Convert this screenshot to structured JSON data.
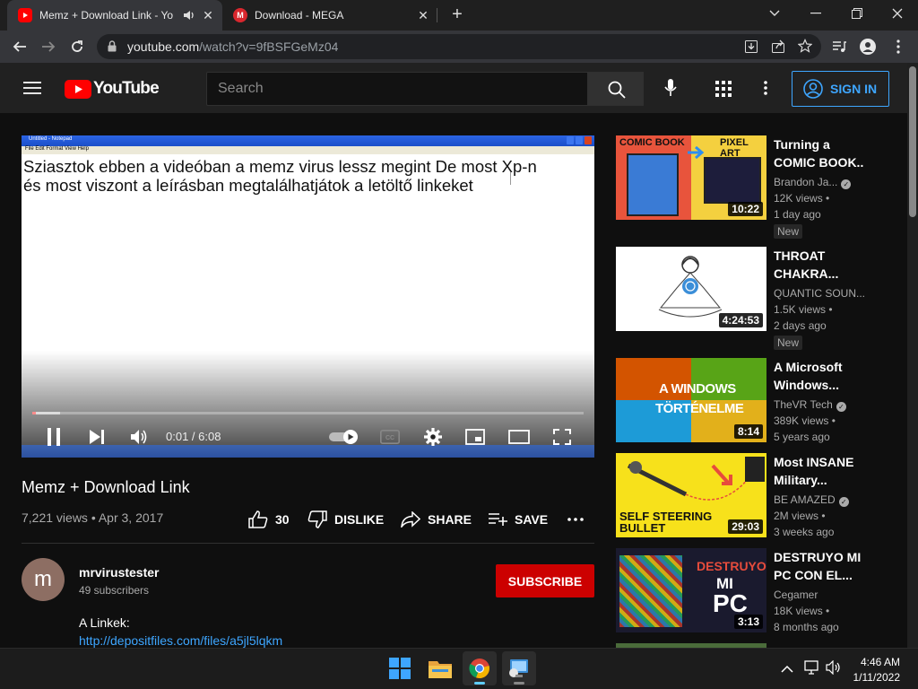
{
  "browser": {
    "tabs": [
      {
        "title": "Memz + Download Link - Yo",
        "favicon": "youtube-favicon",
        "active": true
      },
      {
        "title": "Download - MEGA",
        "favicon": "mega-favicon",
        "active": false
      }
    ],
    "url": {
      "host": "youtube.com",
      "path": "/watch?v=9fBSFGeMz04"
    },
    "new_tab_label": "+"
  },
  "youtube": {
    "logo_text": "YouTube",
    "search_placeholder": "Search",
    "sign_in_label": "SIGN IN",
    "colors": {
      "brand_red": "#ff0000",
      "accent_blue": "#3ea6ff",
      "subscribe_red": "#cc0000"
    }
  },
  "player": {
    "notepad_title": "Untitled - Notepad",
    "notepad_menu": "File  Edit  Format  View  Help",
    "notepad_text_line1": "Sziasztok ebben a videóban a memz virus lessz megint De most Xp-n",
    "notepad_text_line2": "és most viszont a leírásban megtalálhatjátok a letöltő linkeket",
    "time": "0:01 / 6:08",
    "progress_fraction": 0.003,
    "buffered_fraction": 0.05
  },
  "video": {
    "title": "Memz + Download Link",
    "meta": "7,221 views • Apr 3, 2017",
    "like_count": "30",
    "dislike_label": "DISLIKE",
    "share_label": "SHARE",
    "save_label": "SAVE"
  },
  "channel": {
    "avatar_letter": "m",
    "name": "mrvirustester",
    "subscribers": "49 subscribers",
    "subscribe_label": "SUBSCRIBE"
  },
  "description": {
    "line1": "A Linkek:",
    "link": "http://depositfiles.com/files/a5jl5lqkm"
  },
  "related": [
    {
      "title1": "Turning a",
      "title2": "COMIC BOOK...",
      "channel": "Brandon Ja...",
      "verified": true,
      "views": "12K views •",
      "ago": "1 day ago",
      "badge": "New",
      "duration": "10:22",
      "thumb_text1": "COMIC BOOK",
      "thumb_text2": "PIXEL ART"
    },
    {
      "title1": "THROAT",
      "title2": "CHAKRA...",
      "channel": "QUANTIC SOUN...",
      "verified": false,
      "views": "1.5K views •",
      "ago": "2 days ago",
      "badge": "New",
      "duration": "4:24:53"
    },
    {
      "title1": "A Microsoft",
      "title2": "Windows...",
      "channel": "TheVR Tech",
      "verified": true,
      "views": "389K views •",
      "ago": "5 years ago",
      "badge": "",
      "duration": "8:14",
      "thumb_text1": "A WINDOWS",
      "thumb_text2": "TÖRTÉNELME"
    },
    {
      "title1": "Most INSANE",
      "title2": "Military...",
      "channel": "BE AMAZED",
      "verified": true,
      "views": "2M views •",
      "ago": "3 weeks ago",
      "badge": "",
      "duration": "29:03",
      "thumb_text1": "SELF STEERING",
      "thumb_text2": "BULLET"
    },
    {
      "title1": "DESTRUYO MI",
      "title2": "PC CON EL...",
      "channel": "Cegamer",
      "verified": false,
      "views": "18K views •",
      "ago": "8 months ago",
      "badge": "",
      "duration": "3:13",
      "thumb_text1": "DESTRUYO",
      "thumb_text2": "MI",
      "thumb_text3": "PC"
    }
  ],
  "taskbar": {
    "apps": [
      "windows-start-icon",
      "file-explorer-icon",
      "chrome-icon",
      "remote-desktop-icon"
    ],
    "time": "4:46 AM",
    "date": "1/11/2022"
  }
}
